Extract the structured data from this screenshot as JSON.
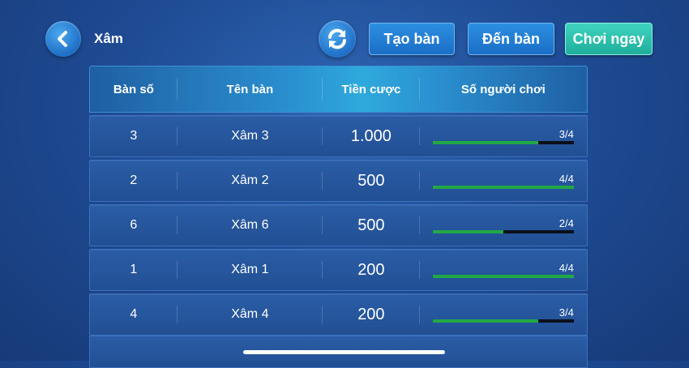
{
  "header": {
    "title": "Xâm",
    "buttons": {
      "create": "Tạo bàn",
      "goto": "Đến bàn",
      "play_now": "Chơi ngay"
    }
  },
  "table": {
    "columns": [
      "Bàn số",
      "Tên bàn",
      "Tiền cược",
      "Số người chơi"
    ],
    "rows": [
      {
        "number": "3",
        "name": "Xâm 3",
        "bet": "1.000",
        "players": "3/4",
        "fill": 0.75
      },
      {
        "number": "2",
        "name": "Xâm 2",
        "bet": "500",
        "players": "4/4",
        "fill": 1.0
      },
      {
        "number": "6",
        "name": "Xâm 6",
        "bet": "500",
        "players": "2/4",
        "fill": 0.5
      },
      {
        "number": "1",
        "name": "Xâm 1",
        "bet": "200",
        "players": "4/4",
        "fill": 1.0
      },
      {
        "number": "4",
        "name": "Xâm 4",
        "bet": "200",
        "players": "3/4",
        "fill": 0.75
      }
    ]
  },
  "colors": {
    "progress_fill": "#22a845",
    "progress_track": "#0b0f1a",
    "play_button": "#2fc3ae",
    "blue_button": "#2080d6"
  },
  "icons": {
    "back": "chevron-left-icon",
    "refresh": "refresh-icon"
  }
}
